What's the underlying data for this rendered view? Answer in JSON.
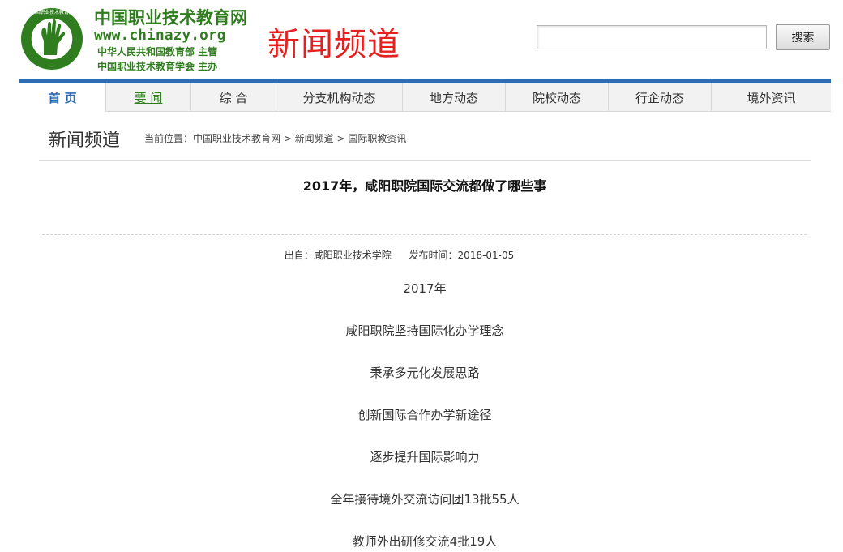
{
  "header": {
    "site_name": "中国职业技术教育网",
    "site_url": "www.chinazy.org",
    "sponsor_line1": "中华人民共和国教育部 主管",
    "sponsor_line2": "中国职业技术教育学会 主办",
    "channel_title": "新闻频道",
    "logo_icon": "chinazy-seal-logo",
    "brand_color": "#2f7d1e",
    "channel_color": "#e61f1f"
  },
  "search": {
    "value": "",
    "placeholder": "",
    "button_label": "搜索"
  },
  "nav": {
    "accent_color": "#2e6db3",
    "items": [
      {
        "label": "首 页"
      },
      {
        "label": "要 闻"
      },
      {
        "label": "综 合"
      },
      {
        "label": "分支机构动态"
      },
      {
        "label": "地方动态"
      },
      {
        "label": "院校动态"
      },
      {
        "label": "行企动态"
      },
      {
        "label": "境外资讯"
      }
    ]
  },
  "crumb": {
    "section_title": "新闻频道",
    "path": "当前位置：中国职业技术教育网 > 新闻频道 > 国际职教资讯"
  },
  "article": {
    "title": "2017年，咸阳职院国际交流都做了哪些事",
    "source": "出自：咸阳职业技术学院",
    "published": "发布时间：2018-01-05",
    "lines": [
      "2017年",
      "咸阳职院坚持国际化办学理念",
      "秉承多元化发展思路",
      "创新国际合作办学新途径",
      "逐步提升国际影响力",
      "全年接待境外交流访问团13批55人",
      "教师外出研修交流4批19人"
    ]
  }
}
